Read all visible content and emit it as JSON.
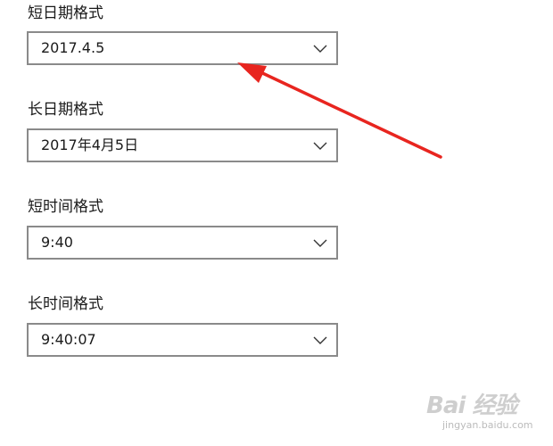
{
  "settings": {
    "fields": [
      {
        "label": "短日期格式",
        "value": "2017.4.5"
      },
      {
        "label": "长日期格式",
        "value": "2017年4月5日"
      },
      {
        "label": "短时间格式",
        "value": "9:40"
      },
      {
        "label": "长时间格式",
        "value": "9:40:07"
      }
    ]
  },
  "annotation": {
    "arrow_color": "#e8251f"
  },
  "watermark": {
    "logo": "Bai 经验",
    "url": "jingyan.baidu.com"
  },
  "colors": {
    "border": "#8a8a8a",
    "text": "#1a1a1a",
    "background": "#ffffff"
  }
}
